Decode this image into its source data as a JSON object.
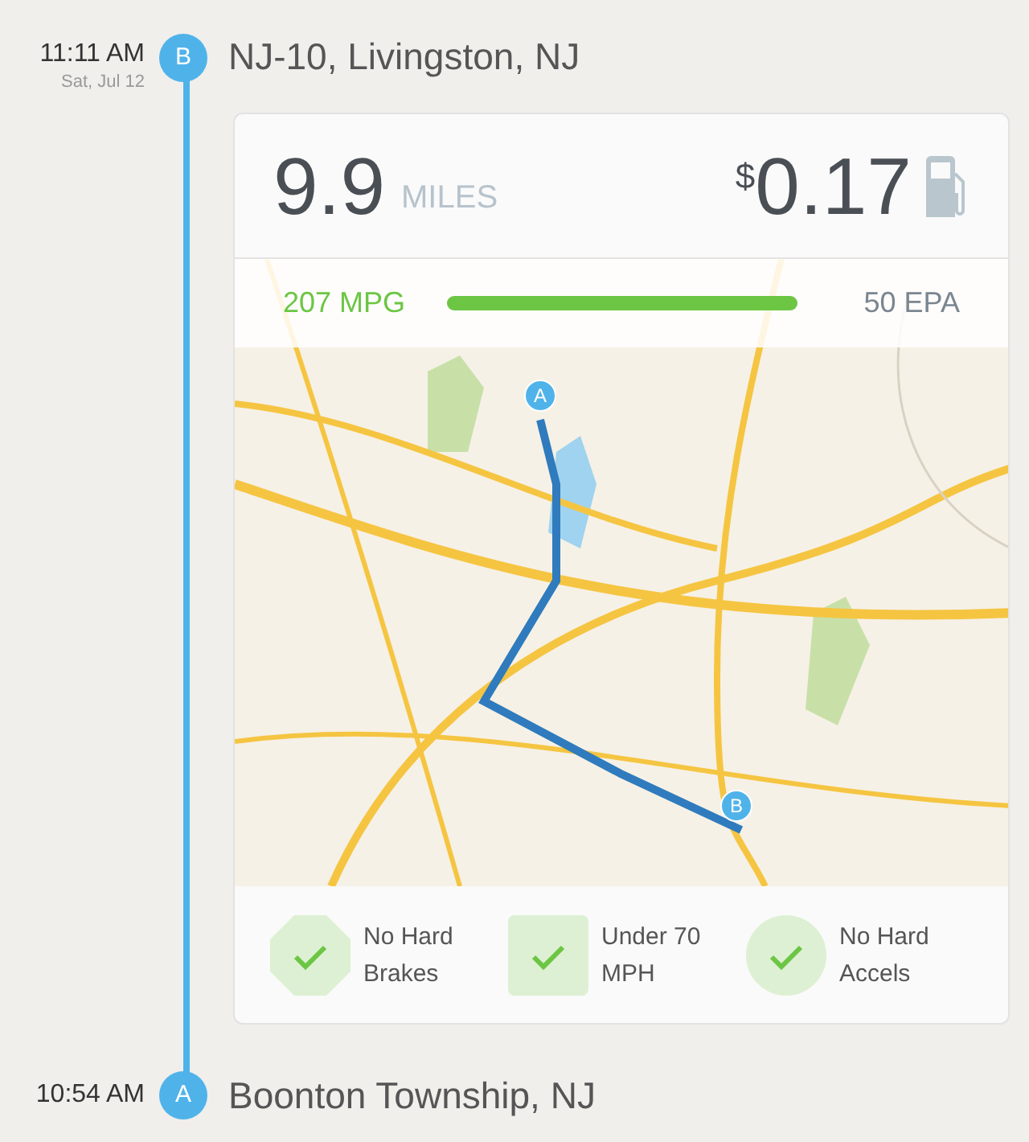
{
  "end_stop": {
    "time": "11:11 AM",
    "date": "Sat, Jul 12",
    "marker": "B",
    "place": "NJ-10, Livingston, NJ"
  },
  "trip": {
    "distance": "9.9",
    "distance_unit": "MILES",
    "currency": "$",
    "cost": "0.17"
  },
  "efficiency": {
    "mpg": "207 MPG",
    "level": 1,
    "epa": "50 EPA"
  },
  "map": {
    "pins": [
      {
        "label": "A"
      },
      {
        "label": "B"
      }
    ]
  },
  "badges": [
    {
      "kind": "octagon",
      "text": "No Hard Brakes"
    },
    {
      "kind": "square",
      "text": "Under 70 MPH"
    },
    {
      "kind": "circle",
      "text": "No Hard Accels"
    }
  ],
  "start_stop": {
    "time": "10:54 AM",
    "marker": "A",
    "place": "Boonton Township, NJ"
  }
}
